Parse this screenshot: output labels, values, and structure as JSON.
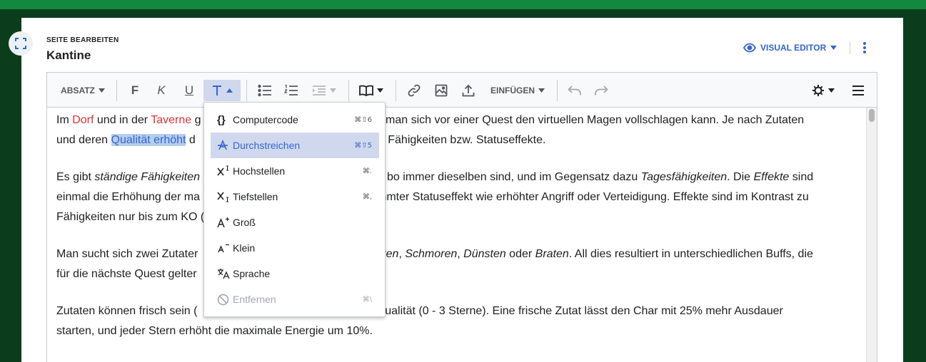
{
  "header": {
    "mode_label": "SEITE BEARBEITEN",
    "page_title": "Kantine",
    "editor_switch_label": "VISUAL EDITOR"
  },
  "toolbar": {
    "paragraph_label": "ABSATZ",
    "bold_label": "F",
    "italic_label": "K",
    "underline_label": "U",
    "insert_label": "EINFÜGEN"
  },
  "style_menu": {
    "items": [
      {
        "label": "Computercode",
        "shortcut": "⌘⇧6",
        "icon": "braces-icon",
        "state": "normal"
      },
      {
        "label": "Durchstreichen",
        "shortcut": "⌘⇧5",
        "icon": "strikethrough-icon",
        "state": "highlighted"
      },
      {
        "label": "Hochstellen",
        "shortcut": "⌘.",
        "icon": "superscript-icon",
        "state": "normal"
      },
      {
        "label": "Tiefstellen",
        "shortcut": "⌘,",
        "icon": "subscript-icon",
        "state": "normal"
      },
      {
        "label": "Groß",
        "shortcut": "",
        "icon": "bigger-icon",
        "state": "normal"
      },
      {
        "label": "Klein",
        "shortcut": "",
        "icon": "smaller-icon",
        "state": "normal"
      },
      {
        "label": "Sprache",
        "shortcut": "",
        "icon": "language-icon",
        "state": "normal"
      },
      {
        "label": "Entfernen",
        "shortcut": "⌘\\",
        "icon": "remove-format-icon",
        "state": "disabled"
      }
    ]
  },
  "content": {
    "p1": {
      "t1": "Im ",
      "link_dorf": "Dorf",
      "t2": " und in der ",
      "link_taverne": "Taverne",
      "t3": " g",
      "t4": "i dem man sich vor einer Quest den virtuellen Magen vollschlagen kann. Je nach Zutaten",
      "t5": "und deren ",
      "selected": "Qualität erhöht",
      "t6": " d",
      "t7": "s Fähigkeiten bzw. Statuseffekte."
    },
    "p2": {
      "t1": "Es gibt ",
      "em1": "ständige Fähigkeiten",
      "t2": "bo immer dieselben sind, und im Gegensatz dazu ",
      "em2": "Tagesfähigkeiten",
      "t3": ". Die ",
      "em3": "Effekte",
      "t4": " sind",
      "t5": "einmal die Erhöhung der ma",
      "t6": "timmter Statuseffekt wie erhöhter Angriff oder Verteidigung. Effekte sind im Kontrast zu",
      "t7": "Fähigkeiten nur bis zum KO ("
    },
    "p3": {
      "t1": "Man sucht sich zwei Zutater",
      "em1": "uten",
      "t2": ", ",
      "em2": "Schmoren",
      "t3": ", ",
      "em3": "Dünsten",
      "t4": " oder ",
      "em4": "Braten",
      "t5": ". All dies resultiert in unterschiedlichen Buffs, die",
      "t6": "für die nächste Quest gelter"
    },
    "p4": {
      "t1": "Zutaten können frisch sein (",
      "t2": "e Qualität (0 - 3 Sterne). Eine frische Zutat lässt den Char mit 25% mehr Ausdauer",
      "t3": "starten, und jeder Stern erhöht die maximale Energie um 10%."
    }
  },
  "colors": {
    "accent": "#3366cc",
    "link_red": "#dd3333",
    "top_strip": "#14883e",
    "background": "#0b3d1c"
  }
}
